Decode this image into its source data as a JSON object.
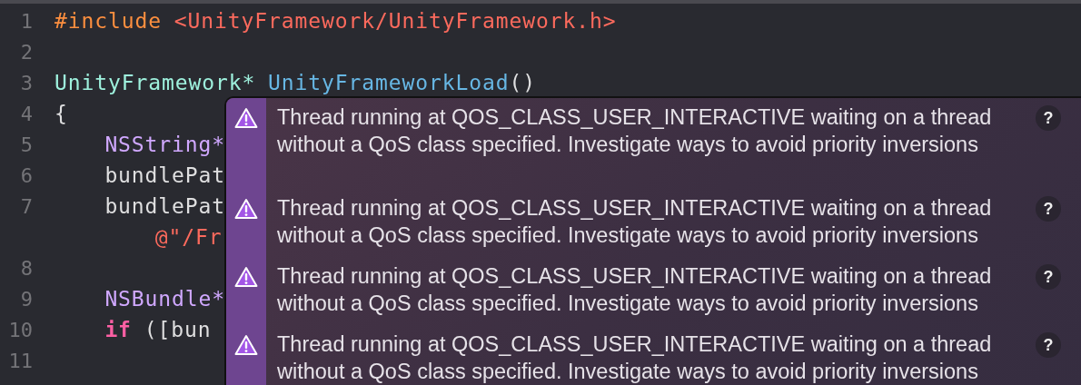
{
  "editor": {
    "lines": [
      {
        "number": "1",
        "kind": "top",
        "tokens": [
          {
            "text": "#include",
            "kind": "preprocessor"
          },
          {
            "text": "<UnityFramework/UnityFramework.h>",
            "kind": "string",
            "space_before": true
          }
        ]
      },
      {
        "number": "2",
        "kind": "blank"
      },
      {
        "number": "3",
        "kind": "top",
        "tokens": [
          {
            "text": "UnityFramework*",
            "kind": "type"
          },
          {
            "text": "UnityFrameworkLoad",
            "kind": "function",
            "space_before": true
          },
          {
            "text": "()",
            "kind": "plain"
          }
        ]
      },
      {
        "number": "4",
        "kind": "top",
        "tokens": [
          {
            "text": "{",
            "kind": "plain"
          }
        ]
      },
      {
        "number": "5",
        "kind": "body",
        "tokens": [
          {
            "text": "NSString*",
            "kind": "class"
          }
        ]
      },
      {
        "number": "6",
        "kind": "body",
        "tokens": [
          {
            "text": "bundlePat",
            "kind": "plain"
          }
        ]
      },
      {
        "number": "7",
        "kind": "body",
        "tokens": [
          {
            "text": "bundlePat",
            "kind": "plain"
          }
        ]
      },
      {
        "kind": "continuation",
        "tokens": [
          {
            "text": "@\"/Fr",
            "kind": "string"
          }
        ]
      },
      {
        "number": "8",
        "kind": "blank"
      },
      {
        "number": "9",
        "kind": "body",
        "tokens": [
          {
            "text": "NSBundle*",
            "kind": "class"
          }
        ]
      },
      {
        "number": "10",
        "kind": "body",
        "tokens": [
          {
            "text": "if",
            "kind": "keyword"
          },
          {
            "text": "([bun",
            "kind": "plain",
            "space_before": true
          }
        ]
      },
      {
        "number": "11",
        "kind": "blank"
      }
    ]
  },
  "issues_popup": {
    "issues": [
      {
        "kind": "warning",
        "message": "Thread running at QOS_CLASS_USER_INTERACTIVE waiting on a thread without a QoS class specified. Investigate ways to avoid priority inversions",
        "help": "?"
      },
      {
        "kind": "warning",
        "message": "Thread running at QOS_CLASS_USER_INTERACTIVE waiting on a thread without a QoS class specified. Investigate ways to avoid priority inversions",
        "help": "?"
      },
      {
        "kind": "warning",
        "message": "Thread running at QOS_CLASS_USER_INTERACTIVE waiting on a thread without a QoS class specified. Investigate ways to avoid priority inversions",
        "help": "?"
      },
      {
        "kind": "warning",
        "message": "Thread running at QOS_CLASS_USER_INTERACTIVE waiting on a thread without a QoS class specified. Investigate ways to avoid priority inversions",
        "help": "?"
      }
    ]
  }
}
